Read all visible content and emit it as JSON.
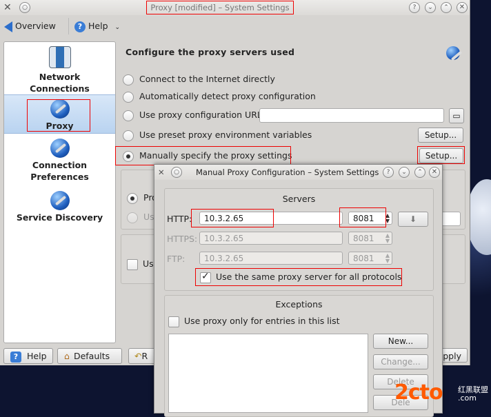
{
  "window": {
    "title": "Proxy [modified] – System Settings"
  },
  "toolbar": {
    "overview_label": "Overview",
    "help_label": "Help"
  },
  "sidebar": {
    "items": [
      {
        "label_line1": "Network",
        "label_line2": "Connections"
      },
      {
        "label_line1": "Proxy"
      },
      {
        "label_line1": "Connection",
        "label_line2": "Preferences"
      },
      {
        "label_line1": "Service Discovery"
      }
    ]
  },
  "main": {
    "heading": "Configure the proxy servers used",
    "options": [
      {
        "label": "Connect to the Internet directly",
        "selected": false
      },
      {
        "label": "Automatically detect proxy configuration",
        "selected": false
      },
      {
        "label": "Use proxy configuration URL:",
        "selected": false
      },
      {
        "label": "Use preset proxy environment variables",
        "selected": false
      },
      {
        "label": "Manually specify the proxy settings",
        "selected": true
      }
    ],
    "setup_label": "Setup...",
    "partial_radio_1": "Pro",
    "partial_radio_2": "Us",
    "partial_check": "Us"
  },
  "bottom": {
    "help_label": "Help",
    "defaults_label": "Defaults",
    "reset_partial": "R",
    "apply_partial": "pply"
  },
  "dialog": {
    "title": "Manual Proxy Configuration – System Settings",
    "servers_title": "Servers",
    "http_label": "HTTP:",
    "http_value": "10.3.2.65",
    "http_port": "8081",
    "https_label": "HTTPS:",
    "https_value": "10.3.2.65",
    "https_port": "8081",
    "ftp_label": "FTP:",
    "ftp_value": "10.3.2.65",
    "ftp_port": "8081",
    "same_proxy_label": "Use the same proxy server for all protocols",
    "same_proxy_checked": true,
    "exceptions_title": "Exceptions",
    "use_only_label": "Use proxy only for entries in this list",
    "new_label": "New...",
    "change_label": "Change...",
    "delete_label": "Delete",
    "delete_all_partial": "Dele"
  },
  "watermark": {
    "brand": "2cto",
    "line1": "红黑联盟",
    "line2": ".com"
  }
}
